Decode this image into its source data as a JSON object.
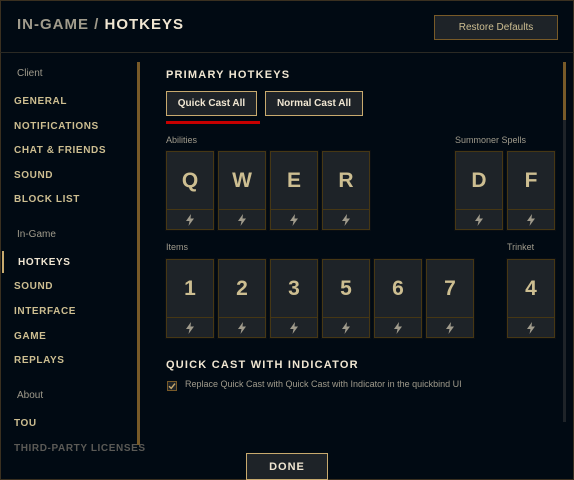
{
  "header": {
    "breadcrumb_parent": "IN-GAME",
    "breadcrumb_separator": " / ",
    "breadcrumb_current": "HOTKEYS",
    "restore_label": "Restore Defaults"
  },
  "sidebar": {
    "client_heading": "Client",
    "client_items": [
      "GENERAL",
      "NOTIFICATIONS",
      "CHAT & FRIENDS",
      "SOUND",
      "BLOCK LIST"
    ],
    "ingame_heading": "In-Game",
    "ingame_items": [
      "HOTKEYS",
      "SOUND",
      "INTERFACE",
      "GAME",
      "REPLAYS"
    ],
    "active_item": "HOTKEYS",
    "about_heading": "About",
    "about_items": [
      "TOU",
      "THIRD-PARTY LICENSES"
    ]
  },
  "primary": {
    "title": "PRIMARY HOTKEYS",
    "quick_cast_all": "Quick Cast All",
    "normal_cast_all": "Normal Cast All",
    "abilities_label": "Abilities",
    "abilities": [
      "Q",
      "W",
      "E",
      "R"
    ],
    "summoner_label": "Summoner Spells",
    "summoner": [
      "D",
      "F"
    ],
    "items_label": "Items",
    "items": [
      "1",
      "2",
      "3",
      "5",
      "6",
      "7"
    ],
    "trinket_label": "Trinket",
    "trinket": [
      "4"
    ]
  },
  "indicator": {
    "title": "QUICK CAST WITH INDICATOR",
    "checkbox_label": "Replace Quick Cast with Quick Cast with Indicator in the quickbind UI",
    "checked": true
  },
  "footer": {
    "done_label": "DONE"
  },
  "colors": {
    "gold": "#c8aa6e",
    "accent_red": "#c80000",
    "background": "#010a13"
  },
  "icons": {
    "quick_cast": "lightning-bolt-icon",
    "check": "checkmark-icon"
  }
}
